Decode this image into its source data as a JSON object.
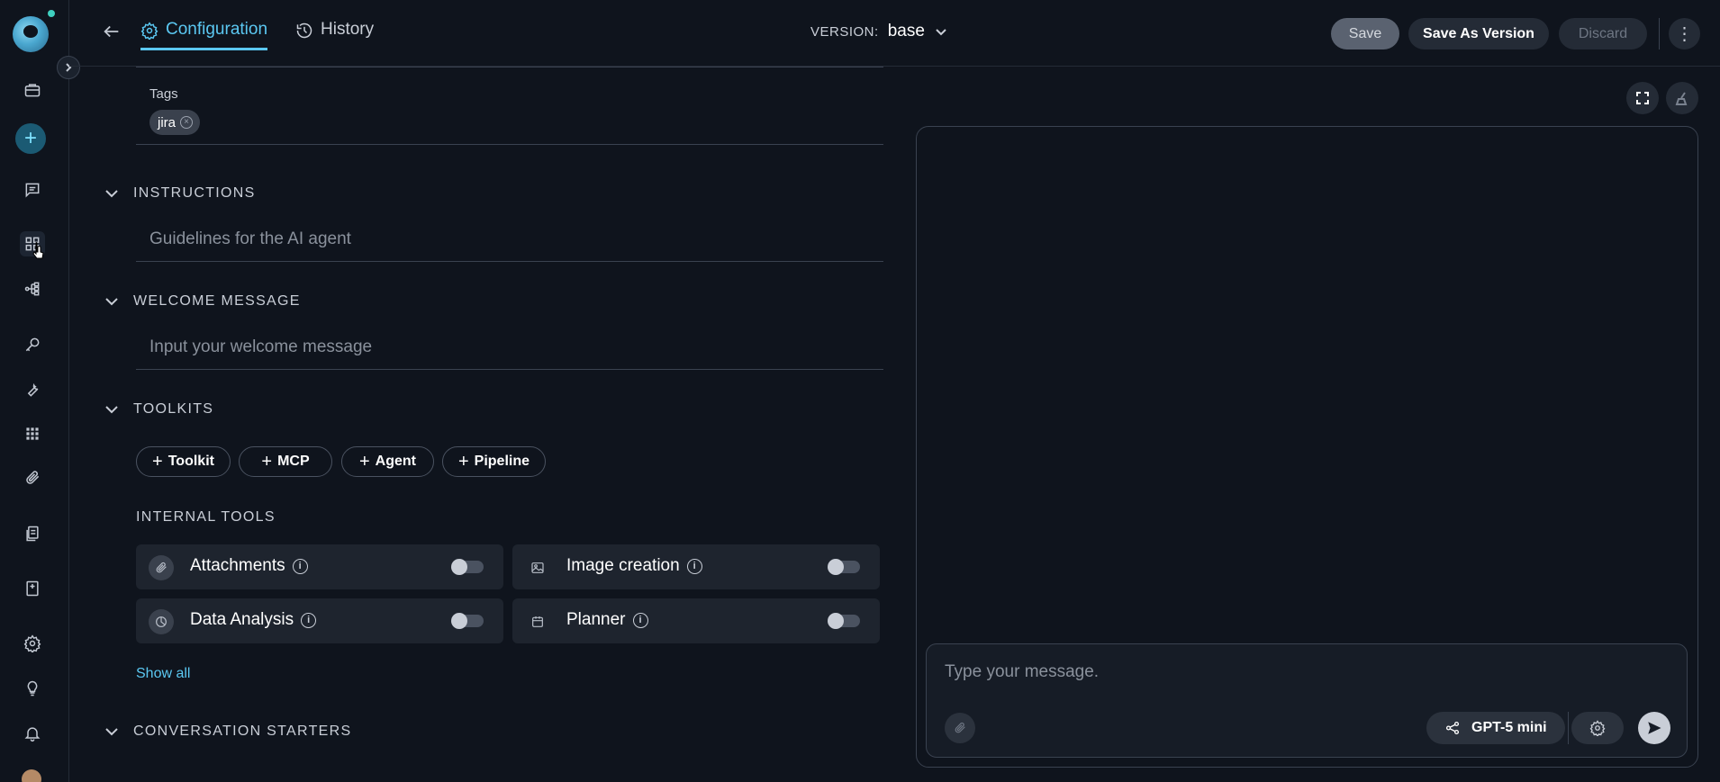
{
  "topbar": {
    "tabs": [
      {
        "label": "Configuration",
        "icon": "gear-icon",
        "active": true
      },
      {
        "label": "History",
        "icon": "history-icon",
        "active": false
      }
    ],
    "version_label": "VERSION:",
    "version_value": "base",
    "save_label": "Save",
    "save_as_version_label": "Save As Version",
    "discard_label": "Discard"
  },
  "sidebar": {
    "icons": [
      "logo",
      "briefcase-icon",
      "add-icon",
      "chat-icon",
      "grid-icon",
      "flow-icon",
      "key-icon",
      "wrench-icon",
      "apps-icon",
      "paperclip-icon",
      "documents-icon",
      "notebook-icon",
      "settings-icon",
      "lightbulb-icon",
      "bell-icon",
      "avatar"
    ]
  },
  "config": {
    "tags_label": "Tags",
    "tags": [
      "jira"
    ],
    "instructions": {
      "title": "INSTRUCTIONS",
      "placeholder": "Guidelines for the AI agent"
    },
    "welcome": {
      "title": "WELCOME MESSAGE",
      "placeholder": "Input your welcome message"
    },
    "toolkits": {
      "title": "TOOLKITS",
      "buttons": [
        "Toolkit",
        "MCP",
        "Agent",
        "Pipeline"
      ]
    },
    "internal_tools": {
      "title": "INTERNAL TOOLS",
      "tools": [
        {
          "name": "Attachments",
          "enabled": false
        },
        {
          "name": "Image creation",
          "enabled": false
        },
        {
          "name": "Data Analysis",
          "enabled": false
        },
        {
          "name": "Planner",
          "enabled": false
        }
      ],
      "show_all": "Show all"
    },
    "conversation_starters": {
      "title": "CONVERSATION STARTERS"
    }
  },
  "chat": {
    "placeholder": "Type your message.",
    "model": "GPT-5 mini"
  },
  "colors": {
    "accent": "#5bc8f2",
    "background": "#0f141d",
    "surface": "#1e242e"
  }
}
